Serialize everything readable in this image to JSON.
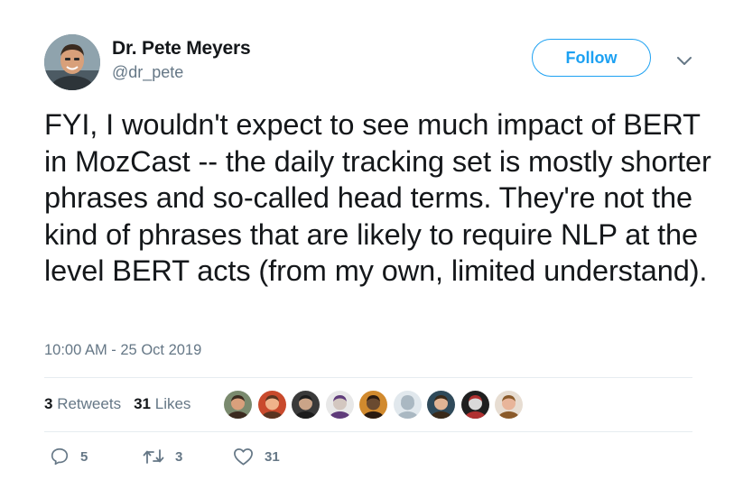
{
  "author": {
    "name": "Dr. Pete Meyers",
    "handle": "@dr_pete",
    "avatar_icon": "profile-photo"
  },
  "follow_button": {
    "label": "Follow"
  },
  "more_menu": {
    "icon": "chevron-down-icon"
  },
  "tweet": {
    "text": "FYI, I wouldn't expect to see much impact of BERT in MozCast -- the daily tracking set is mostly shorter phrases and so-called head terms. They're not the kind of phrases that are likely to require NLP at the level BERT acts (from my own, limited understand).",
    "timestamp": "10:00 AM - 25 Oct 2019"
  },
  "stats": {
    "retweets_count": "3",
    "retweets_label": "Retweets",
    "likes_count": "31",
    "likes_label": "Likes"
  },
  "likers": [
    {
      "bg": "#7a8a6e",
      "skin": "#d9a07c",
      "hair": "#3b2a1f"
    },
    {
      "bg": "#c94a2c",
      "skin": "#f0b38a",
      "hair": "#5a3420"
    },
    {
      "bg": "#3a3a3a",
      "skin": "#caa488",
      "hair": "#1c1c1c"
    },
    {
      "bg": "#e8e8e8",
      "skin": "#d3c7c0",
      "hair": "#5f3b7a"
    },
    {
      "bg": "#d18a2e",
      "skin": "#6a4a30",
      "hair": "#2a1a10"
    },
    {
      "bg": "#e1e8ed",
      "skin": "#aab8c2",
      "hair": "#aab8c2"
    },
    {
      "bg": "#2f4a5a",
      "skin": "#e1b494",
      "hair": "#3a2a1a"
    },
    {
      "bg": "#1f1f1f",
      "skin": "#d9d9d9",
      "hair": "#b03030"
    },
    {
      "bg": "#e7ddd2",
      "skin": "#e8b59a",
      "hair": "#8a5a2a"
    }
  ],
  "actions": {
    "reply": {
      "icon": "reply-icon",
      "count": "5"
    },
    "retweet": {
      "icon": "retweet-icon",
      "count": "3"
    },
    "like": {
      "icon": "heart-icon",
      "count": "31"
    }
  },
  "colors": {
    "accent": "#1da1f2",
    "secondary_text": "#657786",
    "primary_text": "#14171a",
    "divider": "#e6ecf0"
  }
}
